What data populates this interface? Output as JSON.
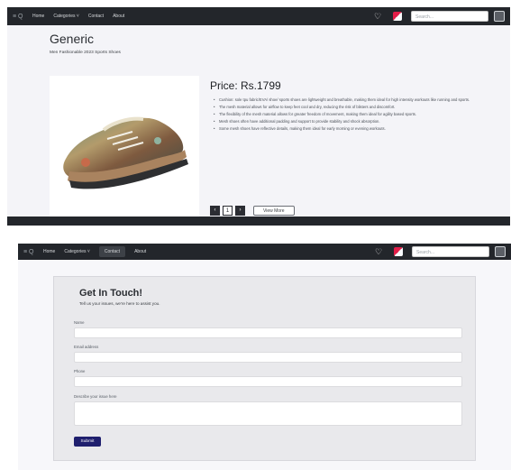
{
  "nav": {
    "brand": "≡ Q",
    "links": [
      "Home",
      "Categories ˅",
      "Contact",
      "About"
    ],
    "search_placeholder": "Search...",
    "icons": [
      "heart-icon",
      "flag-icon",
      "cart-icon"
    ]
  },
  "product": {
    "brand": "Generic",
    "name": "Men Fashionable 2023 Sports Shoes",
    "price": "Price: Rs.1799",
    "bullets": [
      "Cushion: sole tpu fabric/EVA/ shoe/ sports shoes are lightweight and breathable, making them ideal for high intensity workouts like running and sports.",
      "The mesh material allows for airflow to keep feet cool and dry, reducing the risk of blisters and discomfort.",
      "The flexibility of the mesh material allows for greater freedom of movement, making them ideal for agility based sports.",
      "Mesh shoes often have additional padding and support to provide stability and shock absorption.",
      "Some mesh shoes have reflective details, making them ideal for early morning or evening workouts."
    ],
    "pager": [
      "‹",
      "1",
      "›"
    ],
    "view_more": "View More"
  },
  "contact": {
    "title": "Get In Touch!",
    "subtitle": "Tell us your issues, we're here to assist you.",
    "fields": [
      "Name",
      "Email address",
      "Phone",
      "Describe your issue here"
    ],
    "submit": "Submit"
  },
  "colors": {
    "nav_bg": "#23262b",
    "submit_bg": "#1f1f6e"
  }
}
